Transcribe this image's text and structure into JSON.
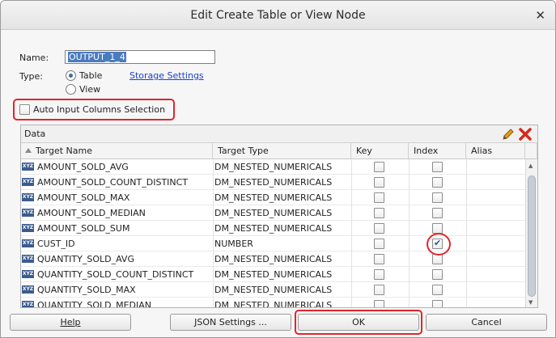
{
  "dialog": {
    "title": "Edit Create Table or View Node",
    "close_glyph": "✕"
  },
  "form": {
    "name_label": "Name:",
    "name_value": "OUTPUT_1_4",
    "type_label": "Type:",
    "type_options": [
      {
        "label": "Table",
        "selected": true
      },
      {
        "label": "View",
        "selected": false
      }
    ],
    "storage_link": "Storage Settings",
    "auto_input_label": "Auto Input Columns Selection",
    "auto_input_checked": false
  },
  "data_panel": {
    "title": "Data",
    "icons": [
      "pencil-icon",
      "delete-icon"
    ],
    "columns": [
      "Target Name",
      "Target Type",
      "Key",
      "Index",
      "Alias"
    ],
    "rows": [
      {
        "name": "AMOUNT_SOLD_AVG",
        "type": "DM_NESTED_NUMERICALS",
        "key": false,
        "index": false,
        "alias": ""
      },
      {
        "name": "AMOUNT_SOLD_COUNT_DISTINCT",
        "type": "DM_NESTED_NUMERICALS",
        "key": false,
        "index": false,
        "alias": ""
      },
      {
        "name": "AMOUNT_SOLD_MAX",
        "type": "DM_NESTED_NUMERICALS",
        "key": false,
        "index": false,
        "alias": ""
      },
      {
        "name": "AMOUNT_SOLD_MEDIAN",
        "type": "DM_NESTED_NUMERICALS",
        "key": false,
        "index": false,
        "alias": ""
      },
      {
        "name": "AMOUNT_SOLD_SUM",
        "type": "DM_NESTED_NUMERICALS",
        "key": false,
        "index": false,
        "alias": ""
      },
      {
        "name": "CUST_ID",
        "type": "NUMBER",
        "key": false,
        "index": true,
        "alias": ""
      },
      {
        "name": "QUANTITY_SOLD_AVG",
        "type": "DM_NESTED_NUMERICALS",
        "key": false,
        "index": false,
        "alias": ""
      },
      {
        "name": "QUANTITY_SOLD_COUNT_DISTINCT",
        "type": "DM_NESTED_NUMERICALS",
        "key": false,
        "index": false,
        "alias": ""
      },
      {
        "name": "QUANTITY_SOLD_MAX",
        "type": "DM_NESTED_NUMERICALS",
        "key": false,
        "index": false,
        "alias": ""
      },
      {
        "name": "QUANTITY_SOLD_MEDIAN",
        "type": "DM_NESTED_NUMERICALS",
        "key": false,
        "index": false,
        "alias": ""
      }
    ],
    "row_icon_text": "XYZ"
  },
  "buttons": {
    "help": "Help",
    "json_settings": "JSON Settings ...",
    "ok": "OK",
    "cancel": "Cancel"
  },
  "colors": {
    "highlight": "#e3242b",
    "link": "#1a3fcc",
    "selection": "#4a7bbf"
  }
}
